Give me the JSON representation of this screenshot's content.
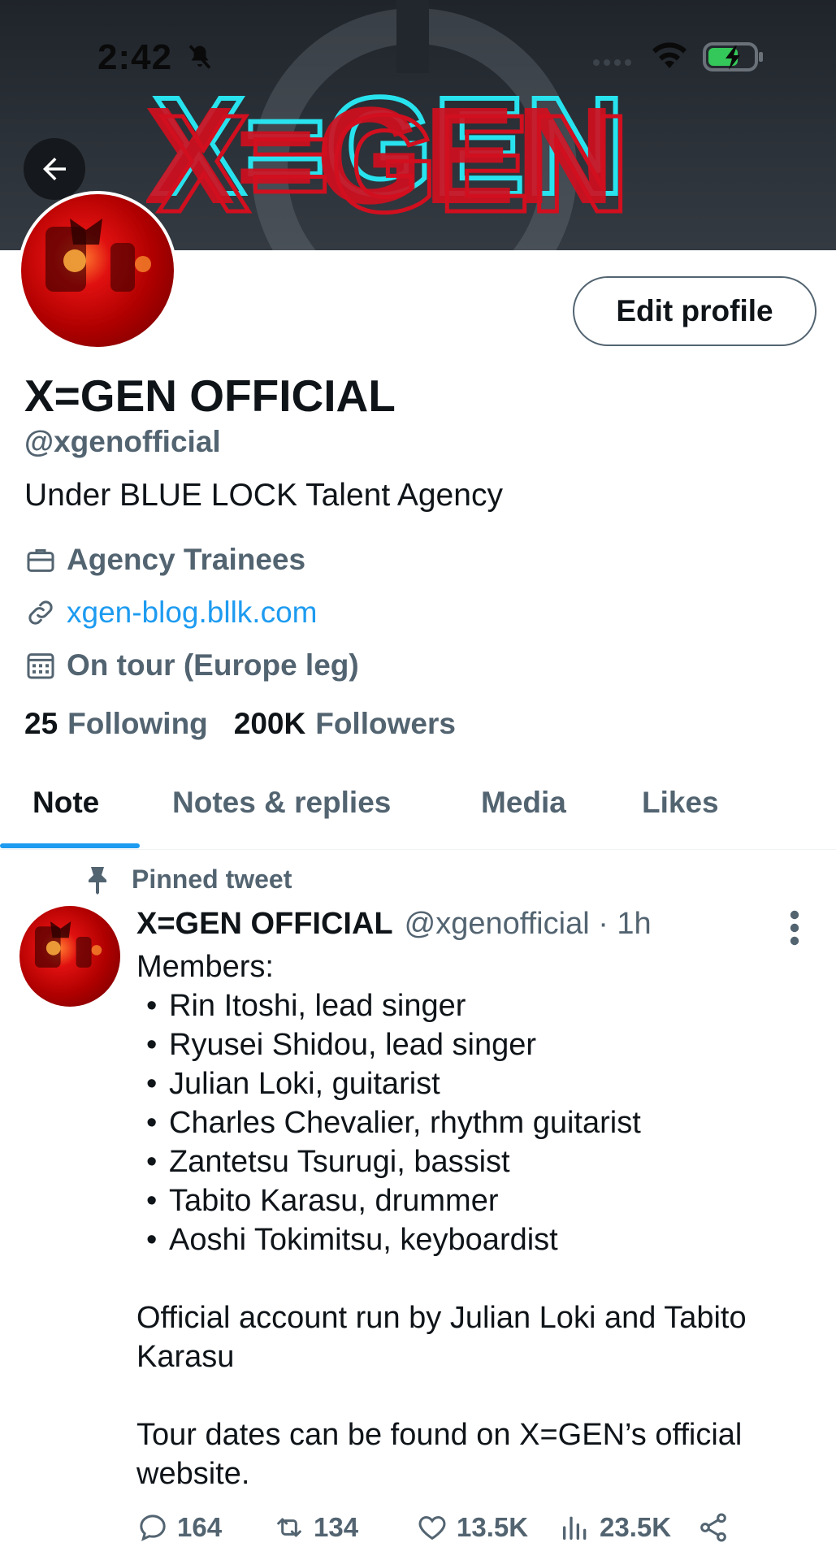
{
  "status_bar": {
    "time": "2:42",
    "icons": [
      "bell-muted-icon",
      "cellular-icon",
      "wifi-icon",
      "battery-charging-icon"
    ],
    "battery_color": "#34c759"
  },
  "banner": {
    "logo_text": "X=GEN",
    "colors": {
      "red": "#d10f1f",
      "cyan": "#28e3ee",
      "dark": "#2a2f35"
    }
  },
  "profile": {
    "display_name": "X=GEN OFFICIAL",
    "handle": "@xgenofficial",
    "bio": "Under BLUE LOCK Talent Agency",
    "category": "Agency Trainees",
    "website": "xgen-blog.bllk.com",
    "joined": "On tour (Europe leg)",
    "following_count": "25",
    "following_label": "Following",
    "followers_count": "200K",
    "followers_label": "Followers",
    "edit_button": "Edit profile"
  },
  "tabs": [
    {
      "label": "Note",
      "active": true
    },
    {
      "label": "Notes & replies",
      "active": false
    },
    {
      "label": "Media",
      "active": false
    },
    {
      "label": "Likes",
      "active": false
    }
  ],
  "accent": "#1d9bf0",
  "tweet": {
    "pinned_label": "Pinned tweet",
    "author_name": "X=GEN OFFICIAL",
    "author_meta": "@xgenofficial · 1h",
    "intro": "Members:",
    "members": [
      "Rin Itoshi, lead singer",
      "Ryusei Shidou, lead singer",
      "Julian Loki, guitarist",
      "Charles Chevalier, rhythm guitarist",
      "Zantetsu Tsurugi, bassist",
      "Tabito Karasu, drummer",
      "Aoshi Tokimitsu, keyboardist"
    ],
    "para1": "Official account run by Julian Loki and Tabito Karasu",
    "para2": "Tour dates can be found on X=GEN’s official website.",
    "replies": "164",
    "retweets": "134",
    "likes": "13.5K",
    "views": "23.5K"
  }
}
